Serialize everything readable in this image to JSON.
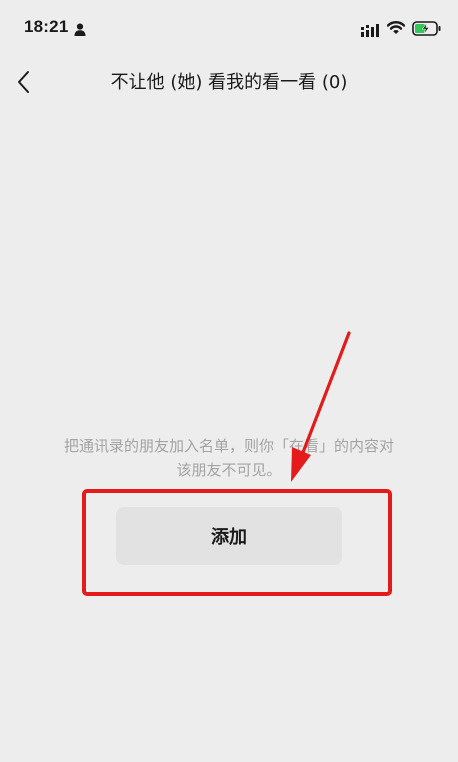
{
  "status_bar": {
    "time": "18:21",
    "icons": [
      "person-icon",
      "cellular-signal-icon",
      "wifi-icon",
      "battery-charging-icon"
    ]
  },
  "nav": {
    "back_icon": "chevron-left-icon",
    "title": "不让他 (她) 看我的看一看 (0)"
  },
  "hint": {
    "line1": "把通讯录的朋友加入名单，则你「在看」的内容对",
    "line2": "该朋友不可见。"
  },
  "add_button": {
    "label": "添加"
  },
  "annotation": {
    "color": "#e51b1b"
  },
  "colors": {
    "background": "#ededed",
    "button_bg": "#e2e2e2",
    "hint_text": "#a3a3a3",
    "battery_fill": "#34c759"
  }
}
